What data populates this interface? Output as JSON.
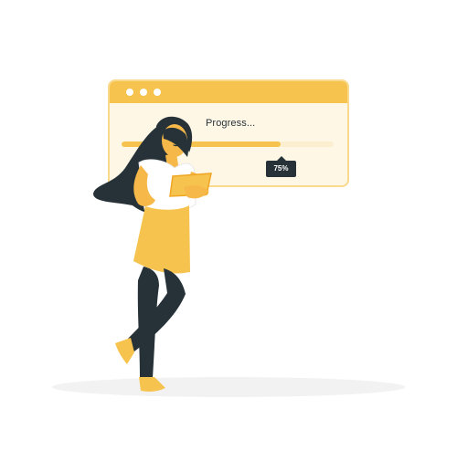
{
  "progress_window": {
    "label": "Progress...",
    "percent_label": "75%",
    "value": 0.75
  },
  "colors": {
    "accent": "#f6c34f",
    "window_background": "#fff7e6",
    "window_border": "#f9d98b",
    "badge_background": "#263238",
    "shadow": "#f2f2f2"
  },
  "icons": {
    "window_controls": [
      "window-dot-icon",
      "window-dot-icon",
      "window-dot-icon"
    ],
    "illustration": "woman-holding-tablet-illustration"
  }
}
